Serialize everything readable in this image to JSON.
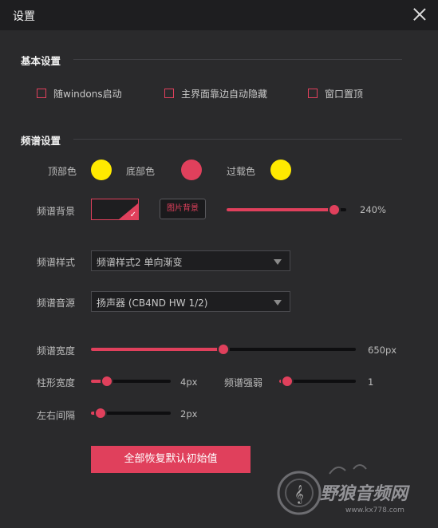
{
  "window": {
    "title": "设置"
  },
  "basic": {
    "title": "基本设置",
    "checkboxes": [
      {
        "label": "随windons启动",
        "checked": false
      },
      {
        "label": "主界面靠边自动隐藏",
        "checked": false
      },
      {
        "label": "窗口置顶",
        "checked": false
      }
    ]
  },
  "spectrum": {
    "title": "频谱设置",
    "colors": {
      "top_label": "顶部色",
      "top": "#ffea00",
      "bottom_label": "底部色",
      "bottom": "#e0405c",
      "overload_label": "过载色",
      "overload": "#ffea00"
    },
    "background": {
      "label": "频谱背景",
      "image_button": "图片背景",
      "opacity_percent": 100,
      "opacity_text": "240%"
    },
    "style": {
      "label": "频谱样式",
      "selected": "频谱样式2 单向渐变"
    },
    "source": {
      "label": "频谱音源",
      "selected": "扬声器 (CB4ND HW 1/2)"
    },
    "width": {
      "label": "频谱宽度",
      "value_text": "650px",
      "fraction": 0.5
    },
    "bar_width": {
      "label": "柱形宽度",
      "value_text": "4px",
      "fraction": 0.2
    },
    "strength": {
      "label": "频谱强弱",
      "value_text": "1",
      "fraction": 0.1
    },
    "spacing": {
      "label": "左右间隔",
      "value_text": "2px",
      "fraction": 0.12
    }
  },
  "reset_button": "全部恢复默认初始值",
  "watermark": {
    "brand": "野狼音频网",
    "url": "www.kx778.com"
  }
}
